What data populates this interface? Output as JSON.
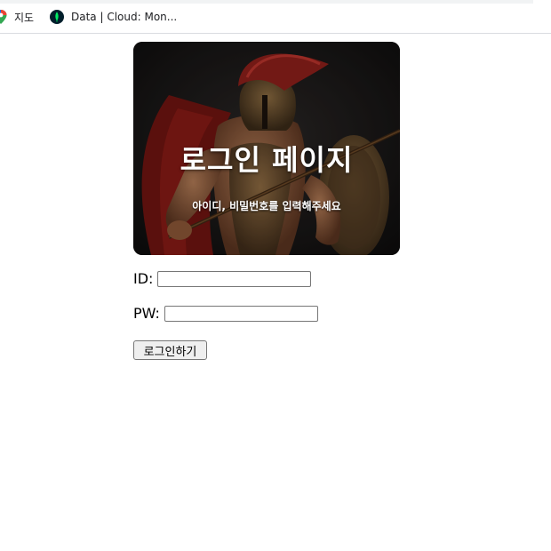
{
  "bookmarks": [
    {
      "label": "지도",
      "icon": "google-maps-icon"
    },
    {
      "label": "Data | Cloud: Mon...",
      "icon": "mongodb-leaf-icon"
    }
  ],
  "hero": {
    "title": "로그인 페이지",
    "subtitle": "아이디, 비밀번호를 입력해주세요",
    "image": "spartan-warrior-photo"
  },
  "form": {
    "id_label": "ID:",
    "id_value": "",
    "pw_label": "PW:",
    "pw_value": "",
    "submit_label": "로그인하기"
  },
  "colors": {
    "hero_background": "#161515",
    "hero_text": "#ffffff",
    "button_background": "#efefef"
  }
}
